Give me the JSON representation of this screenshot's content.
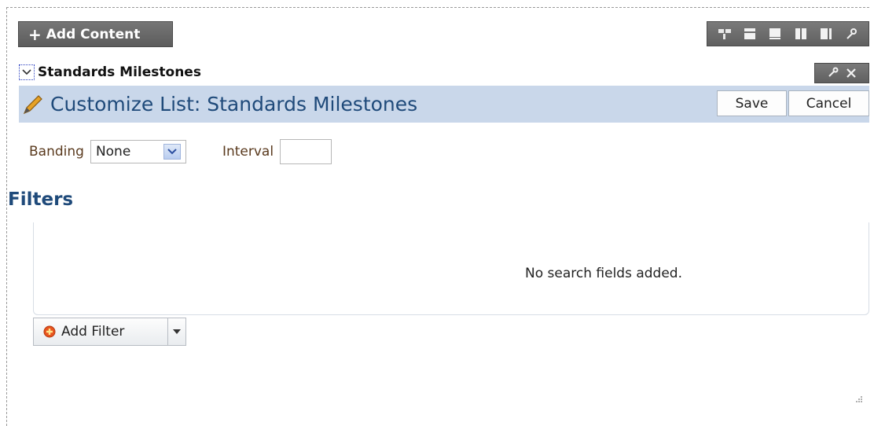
{
  "toolbar": {
    "add_content_label": "Add Content"
  },
  "portlet": {
    "title": "Standards Milestones"
  },
  "customize": {
    "title": "Customize List: Standards Milestones",
    "save_label": "Save",
    "cancel_label": "Cancel"
  },
  "form": {
    "banding_label": "Banding",
    "banding_value": "None",
    "interval_label": "Interval",
    "interval_value": ""
  },
  "filters": {
    "heading": "Filters",
    "empty_message": "No search fields added.",
    "add_filter_label": "Add Filter"
  },
  "colors": {
    "header_band": "#c9d7ea",
    "title_blue": "#1f4a7a",
    "dark_button": "#5c5c5c"
  }
}
